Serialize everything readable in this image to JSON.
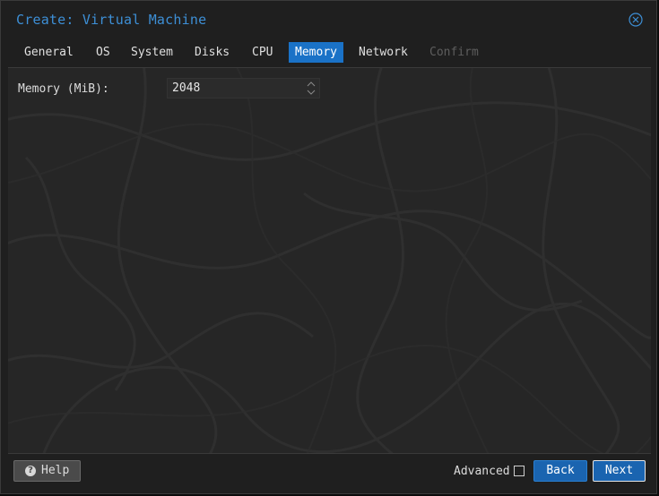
{
  "window": {
    "title": "Create: Virtual Machine",
    "close_icon": "circle-x-icon"
  },
  "tabs": [
    {
      "label": "General",
      "state": "normal"
    },
    {
      "label": "OS",
      "state": "normal"
    },
    {
      "label": "System",
      "state": "normal"
    },
    {
      "label": "Disks",
      "state": "normal"
    },
    {
      "label": "CPU",
      "state": "normal"
    },
    {
      "label": "Memory",
      "state": "active"
    },
    {
      "label": "Network",
      "state": "normal"
    },
    {
      "label": "Confirm",
      "state": "disabled"
    }
  ],
  "memory": {
    "label": "Memory (MiB):",
    "value": "2048",
    "spinner_icon": "spinner-arrows-icon"
  },
  "footer": {
    "help_label": "Help",
    "help_icon": "question-circle-icon",
    "advanced_label": "Advanced",
    "advanced_checked": false,
    "back_label": "Back",
    "next_label": "Next"
  },
  "colors": {
    "accent": "#1a72c7",
    "title": "#3d8fd6",
    "background": "#1f1f1f"
  }
}
